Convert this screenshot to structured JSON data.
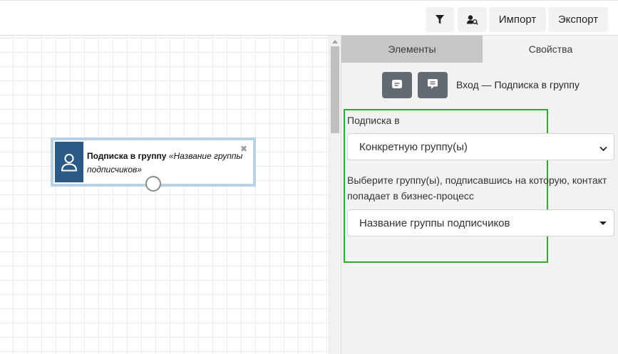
{
  "toolbar": {
    "filter_icon": "filter-icon",
    "user_search_icon": "user-search-icon",
    "import_label": "Импорт",
    "export_label": "Экспорт"
  },
  "canvas": {
    "node": {
      "icon": "user-icon",
      "title": "Подписка в группу",
      "subtitle": "«Название группы подписчиков»",
      "close_glyph": "✖"
    }
  },
  "panel": {
    "tabs": [
      {
        "label": "Элементы",
        "active": false
      },
      {
        "label": "Свойства",
        "active": true
      }
    ],
    "header": {
      "title": "Вход — Подписка в группу",
      "button_icons": [
        "message-square-icon",
        "comment-icon"
      ]
    },
    "form": {
      "subscription_label": "Подписка в",
      "subscription_value": "Конкретную группу(ы)",
      "groups_label_line1": "Выберите группу(ы), подписавшись на которую, контакт",
      "groups_label_line2": "попадает в бизнес-процесс",
      "groups_value": "Название группы подписчиков"
    },
    "highlight_color": "#2eaa2e"
  },
  "colors": {
    "node_icon_bg": "#2c5a86",
    "node_border": "#b9d2e3",
    "header_button_bg": "#636a73",
    "active_tab_bg": "#c6c6c6"
  }
}
